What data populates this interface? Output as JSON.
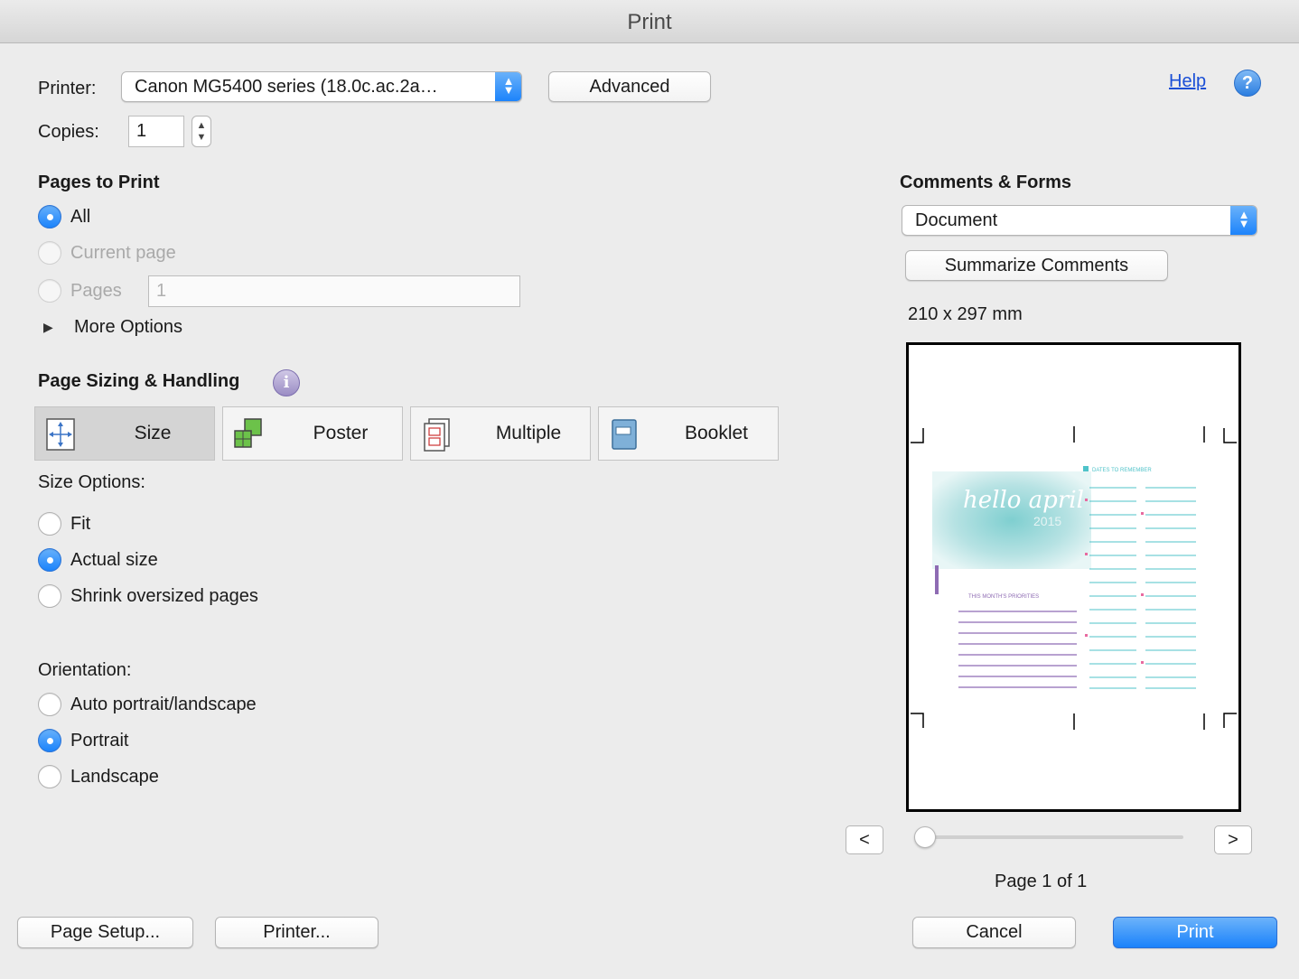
{
  "window": {
    "title": "Print"
  },
  "printer": {
    "label": "Printer:",
    "value": "Canon MG5400 series (18.0c.ac.2a…",
    "advanced_label": "Advanced"
  },
  "copies": {
    "label": "Copies:",
    "value": "1"
  },
  "help": {
    "link_label": "Help",
    "icon_glyph": "?"
  },
  "pages_to_print": {
    "heading": "Pages to Print",
    "options": [
      {
        "label": "All",
        "selected": true,
        "enabled": true
      },
      {
        "label": "Current page",
        "selected": false,
        "enabled": false
      },
      {
        "label": "Pages",
        "selected": false,
        "enabled": false
      }
    ],
    "pages_value": "1",
    "more_options_label": "More Options"
  },
  "page_sizing": {
    "heading": "Page Sizing & Handling",
    "info_glyph": "i",
    "modes": [
      {
        "label": "Size",
        "icon": "size-icon",
        "selected": true
      },
      {
        "label": "Poster",
        "icon": "poster-icon",
        "selected": false
      },
      {
        "label": "Multiple",
        "icon": "multiple-icon",
        "selected": false
      },
      {
        "label": "Booklet",
        "icon": "booklet-icon",
        "selected": false
      }
    ],
    "size_options_label": "Size Options:",
    "size_options": [
      {
        "label": "Fit",
        "selected": false
      },
      {
        "label": "Actual size",
        "selected": true
      },
      {
        "label": "Shrink oversized pages",
        "selected": false
      }
    ]
  },
  "orientation": {
    "label": "Orientation:",
    "options": [
      {
        "label": "Auto portrait/landscape",
        "selected": false
      },
      {
        "label": "Portrait",
        "selected": true
      },
      {
        "label": "Landscape",
        "selected": false
      }
    ]
  },
  "comments_forms": {
    "heading": "Comments & Forms",
    "value": "Document",
    "summarize_label": "Summarize Comments"
  },
  "preview": {
    "paper_size": "210 x 297 mm",
    "page_status": "Page 1 of 1",
    "prev_label": "<",
    "next_label": ">",
    "slider_position": 0,
    "thumb_texts": {
      "headline": "hello april",
      "year": "2015",
      "dates_heading": "DATES TO REMEMBER",
      "priorities_heading": "THIS MONTH'S PRIORITIES"
    }
  },
  "footer": {
    "page_setup_label": "Page Setup...",
    "printer_label": "Printer...",
    "cancel_label": "Cancel",
    "print_label": "Print"
  },
  "colors": {
    "accent": "#1a82fb",
    "teal": "#4fc3c9",
    "purple": "#8e6bb3",
    "pink": "#e86aa0"
  }
}
